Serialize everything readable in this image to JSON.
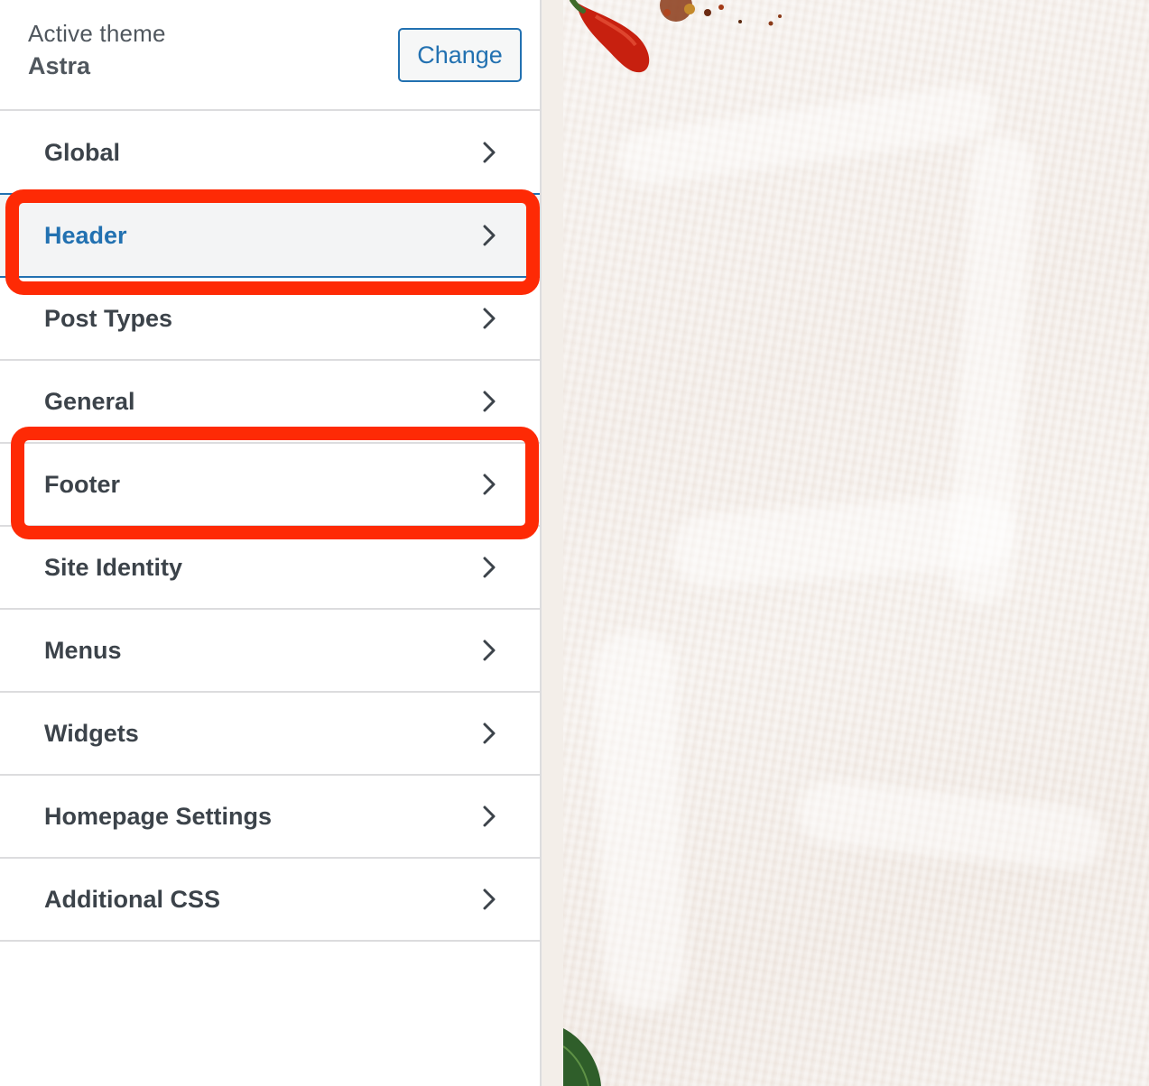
{
  "theme": {
    "caption": "Active theme",
    "name": "Astra",
    "change_label": "Change"
  },
  "menu": {
    "items": [
      {
        "label": "Global",
        "icon": "chevron-right-icon"
      },
      {
        "label": "Header",
        "icon": "chevron-right-icon",
        "active": true
      },
      {
        "label": "Post Types",
        "icon": "chevron-right-icon"
      },
      {
        "label": "General",
        "icon": "chevron-right-icon"
      },
      {
        "label": "Footer",
        "icon": "chevron-right-icon"
      },
      {
        "label": "Site Identity",
        "icon": "chevron-right-icon"
      },
      {
        "label": "Menus",
        "icon": "chevron-right-icon"
      },
      {
        "label": "Widgets",
        "icon": "chevron-right-icon"
      },
      {
        "label": "Homepage Settings",
        "icon": "chevron-right-icon"
      },
      {
        "label": "Additional CSS",
        "icon": "chevron-right-icon"
      }
    ]
  },
  "annotations": {
    "highlighted_items": [
      "Header",
      "Footer"
    ],
    "highlight_color": "#fe2a05"
  },
  "colors": {
    "accent": "#2271b1",
    "text": "#3c434a",
    "active_background": "#f3f4f5",
    "divider": "#dcdcde"
  }
}
